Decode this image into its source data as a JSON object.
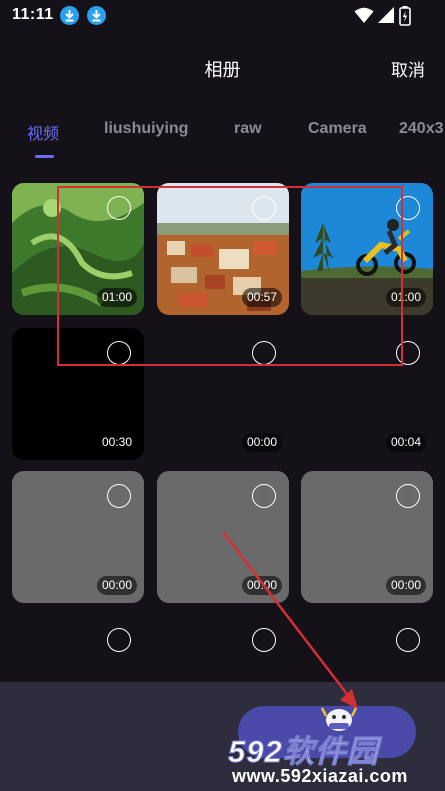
{
  "status_bar": {
    "time": "11:11"
  },
  "header": {
    "title": "相册",
    "cancel": "取消"
  },
  "tabs": [
    {
      "label": "视频",
      "active": true
    },
    {
      "label": "liushuiying",
      "active": false
    },
    {
      "label": "raw",
      "active": false
    },
    {
      "label": "Camera",
      "active": false
    },
    {
      "label": "240x3",
      "active": false
    }
  ],
  "media": [
    {
      "duration": "01:00",
      "thumb": "green-hills"
    },
    {
      "duration": "00:57",
      "thumb": "town-aerial"
    },
    {
      "duration": "01:00",
      "thumb": "motocross"
    },
    {
      "duration": "00:30",
      "thumb": "black"
    },
    {
      "duration": "00:00",
      "thumb": "blank"
    },
    {
      "duration": "00:04",
      "thumb": "blank"
    },
    {
      "duration": "00:00",
      "thumb": "gray"
    },
    {
      "duration": "00:00",
      "thumb": "gray"
    },
    {
      "duration": "00:00",
      "thumb": "gray"
    },
    {
      "duration": "",
      "thumb": "blank"
    },
    {
      "duration": "",
      "thumb": "blank"
    },
    {
      "duration": "",
      "thumb": "blank"
    }
  ],
  "watermark": {
    "brand": "592软件园",
    "url": "www.592xiazai.com"
  },
  "colors": {
    "accent": "#6d6cf5",
    "background": "#141218",
    "annotation": "#d52f36"
  }
}
